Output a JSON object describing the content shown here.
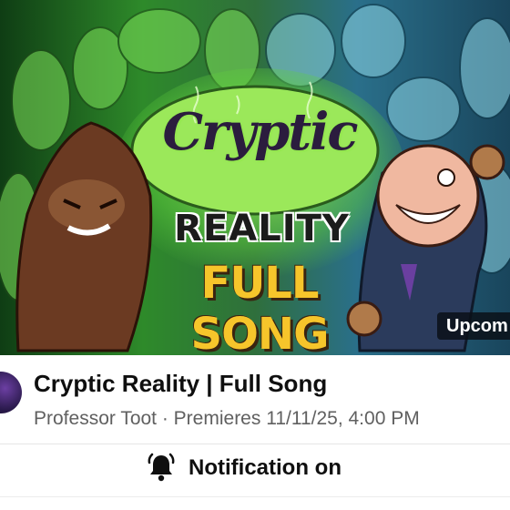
{
  "thumbnail": {
    "art_title_line1": "Cryptic",
    "art_title_line2": "REALITY",
    "art_title_line3": "FULL SONG",
    "badge_label": "Upcom",
    "colors": {
      "left_bg": "#2e8a2a",
      "right_bg": "#2a6f8a",
      "title_yellow": "#f6c52b"
    }
  },
  "video": {
    "title": "Cryptic Reality | Full Song",
    "subtitle": "Professor Toot · Premieres 11/11/25, 4:00 PM"
  },
  "notification": {
    "label": "Notification on",
    "icon": "bell-ringing-icon"
  }
}
